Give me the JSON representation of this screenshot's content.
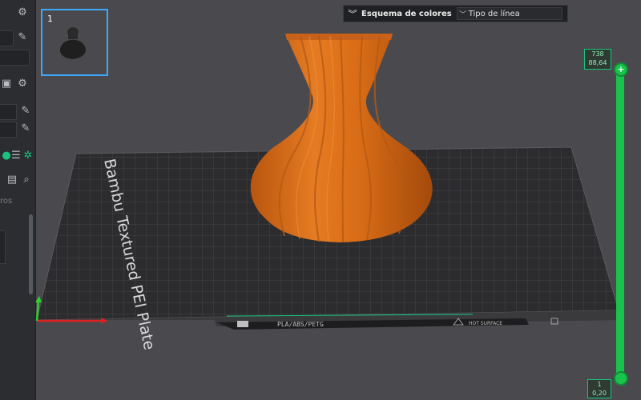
{
  "plate_preview": {
    "number": "1"
  },
  "color_scheme": {
    "label": "Esquema de colores",
    "selected": "Tipo de línea"
  },
  "bed": {
    "name": "Bambu Textured PEI Plate",
    "filament_tag": "PLA/ABS/PETG",
    "surface_tag": "HOT SURFACE"
  },
  "sidebar": {
    "section_label": "ros"
  },
  "layer_slider": {
    "top_layer": "738",
    "top_height": "88,64",
    "bottom_layer": "1",
    "bottom_height": "0,20"
  },
  "colors": {
    "model": "#e0701a",
    "bed": "#2c2c2e",
    "slider": "#19c34b",
    "axis_x": "#e02020",
    "axis_y": "#2bd12b"
  }
}
